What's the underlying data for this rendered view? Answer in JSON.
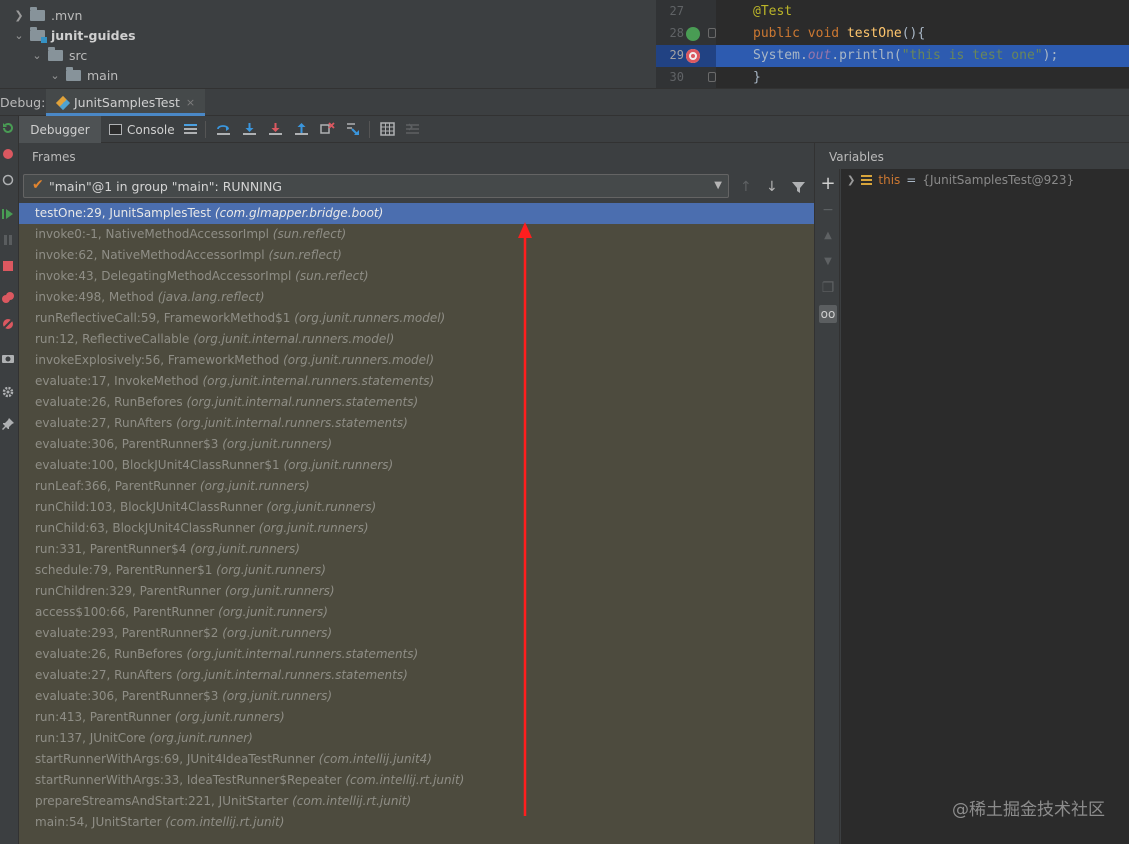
{
  "project_tree": {
    "rows": [
      {
        "label": ".mvn",
        "expanded": false
      },
      {
        "label": "junit-guides",
        "expanded": true
      },
      {
        "label": "src",
        "expanded": true
      },
      {
        "label": "main",
        "expanded": true
      }
    ]
  },
  "editor": {
    "line_numbers": [
      "27",
      "28",
      "29",
      "30"
    ],
    "line27": {
      "annotation": "@Test"
    },
    "line28": {
      "kw1": "public",
      "kw2": "void",
      "method": "testOne",
      "rest": "(){"
    },
    "line29": {
      "obj": "System.",
      "field": "out",
      "call": ".println(",
      "string": "\"this is test one\"",
      "end": ");"
    },
    "line30": {
      "text": "}"
    }
  },
  "debug": {
    "label": "Debug:",
    "tab_title": "JunitSamplesTest",
    "tab_close": "×"
  },
  "toolbar": {
    "debugger_tab": "Debugger",
    "console_tab": "Console"
  },
  "frames": {
    "title": "Frames",
    "thread": "\"main\"@1 in group \"main\": RUNNING",
    "list": [
      {
        "method": "testOne:29, JunitSamplesTest",
        "pkg": "(com.glmapper.bridge.boot)",
        "selected": true
      },
      {
        "method": "invoke0:-1, NativeMethodAccessorImpl",
        "pkg": "(sun.reflect)"
      },
      {
        "method": "invoke:62, NativeMethodAccessorImpl",
        "pkg": "(sun.reflect)"
      },
      {
        "method": "invoke:43, DelegatingMethodAccessorImpl",
        "pkg": "(sun.reflect)"
      },
      {
        "method": "invoke:498, Method",
        "pkg": "(java.lang.reflect)"
      },
      {
        "method": "runReflectiveCall:59, FrameworkMethod$1",
        "pkg": "(org.junit.runners.model)"
      },
      {
        "method": "run:12, ReflectiveCallable",
        "pkg": "(org.junit.internal.runners.model)"
      },
      {
        "method": "invokeExplosively:56, FrameworkMethod",
        "pkg": "(org.junit.runners.model)"
      },
      {
        "method": "evaluate:17, InvokeMethod",
        "pkg": "(org.junit.internal.runners.statements)"
      },
      {
        "method": "evaluate:26, RunBefores",
        "pkg": "(org.junit.internal.runners.statements)"
      },
      {
        "method": "evaluate:27, RunAfters",
        "pkg": "(org.junit.internal.runners.statements)"
      },
      {
        "method": "evaluate:306, ParentRunner$3",
        "pkg": "(org.junit.runners)"
      },
      {
        "method": "evaluate:100, BlockJUnit4ClassRunner$1",
        "pkg": "(org.junit.runners)"
      },
      {
        "method": "runLeaf:366, ParentRunner",
        "pkg": "(org.junit.runners)"
      },
      {
        "method": "runChild:103, BlockJUnit4ClassRunner",
        "pkg": "(org.junit.runners)"
      },
      {
        "method": "runChild:63, BlockJUnit4ClassRunner",
        "pkg": "(org.junit.runners)"
      },
      {
        "method": "run:331, ParentRunner$4",
        "pkg": "(org.junit.runners)"
      },
      {
        "method": "schedule:79, ParentRunner$1",
        "pkg": "(org.junit.runners)"
      },
      {
        "method": "runChildren:329, ParentRunner",
        "pkg": "(org.junit.runners)"
      },
      {
        "method": "access$100:66, ParentRunner",
        "pkg": "(org.junit.runners)"
      },
      {
        "method": "evaluate:293, ParentRunner$2",
        "pkg": "(org.junit.runners)"
      },
      {
        "method": "evaluate:26, RunBefores",
        "pkg": "(org.junit.internal.runners.statements)"
      },
      {
        "method": "evaluate:27, RunAfters",
        "pkg": "(org.junit.internal.runners.statements)"
      },
      {
        "method": "evaluate:306, ParentRunner$3",
        "pkg": "(org.junit.runners)"
      },
      {
        "method": "run:413, ParentRunner",
        "pkg": "(org.junit.runners)"
      },
      {
        "method": "run:137, JUnitCore",
        "pkg": "(org.junit.runner)"
      },
      {
        "method": "startRunnerWithArgs:69, JUnit4IdeaTestRunner",
        "pkg": "(com.intellij.junit4)"
      },
      {
        "method": "startRunnerWithArgs:33, IdeaTestRunner$Repeater",
        "pkg": "(com.intellij.rt.junit)"
      },
      {
        "method": "prepareStreamsAndStart:221, JUnitStarter",
        "pkg": "(com.intellij.rt.junit)"
      },
      {
        "method": "main:54, JUnitStarter",
        "pkg": "(com.intellij.rt.junit)"
      }
    ]
  },
  "variables": {
    "title": "Variables",
    "items": [
      {
        "name": "this",
        "eq": "=",
        "value": "{JunitSamplesTest@923}"
      }
    ]
  },
  "watermark": "@稀土掘金技术社区",
  "colors": {
    "selection": "#4b6eaf",
    "annotation_arrow": "#ff1e1e",
    "frames_background": "#4d4b3e"
  }
}
